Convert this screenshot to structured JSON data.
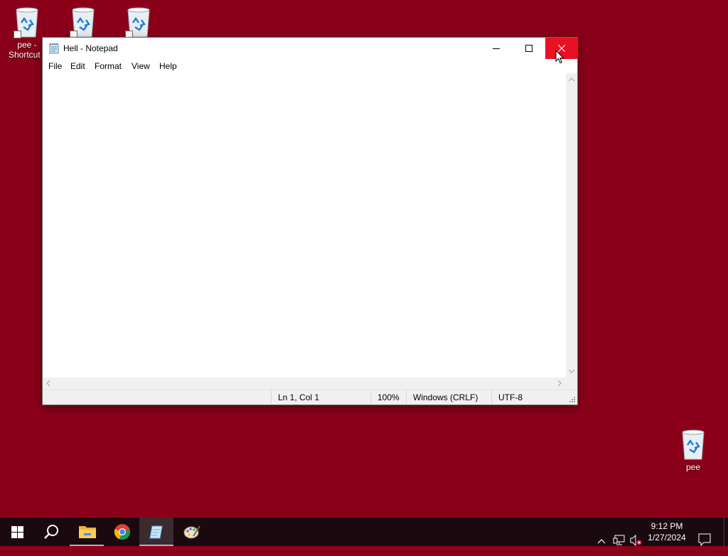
{
  "desktop": {
    "icons": [
      {
        "label": "pee - Shortcut ("
      },
      {
        "label": ""
      },
      {
        "label": ""
      },
      {
        "label": "pee"
      }
    ]
  },
  "notepad": {
    "title": "Hell - Notepad",
    "menu": [
      "File",
      "Edit",
      "Format",
      "View",
      "Help"
    ],
    "content": "",
    "status": {
      "position": "Ln 1, Col 1",
      "zoom": "100%",
      "line_ending": "Windows (CRLF)",
      "encoding": "UTF-8"
    }
  },
  "taskbar": {
    "apps": [
      "start-icon",
      "search-icon",
      "file-explorer-icon",
      "chrome-icon",
      "notepad-icon",
      "paint-icon"
    ],
    "active_app": "notepad-icon",
    "clock": {
      "time": "9:12 PM",
      "date": "1/27/2024"
    }
  },
  "colors": {
    "desktop_bg": "#8b0019",
    "close_hover": "#e81123",
    "taskbar_bg": "#1a0a0f"
  }
}
